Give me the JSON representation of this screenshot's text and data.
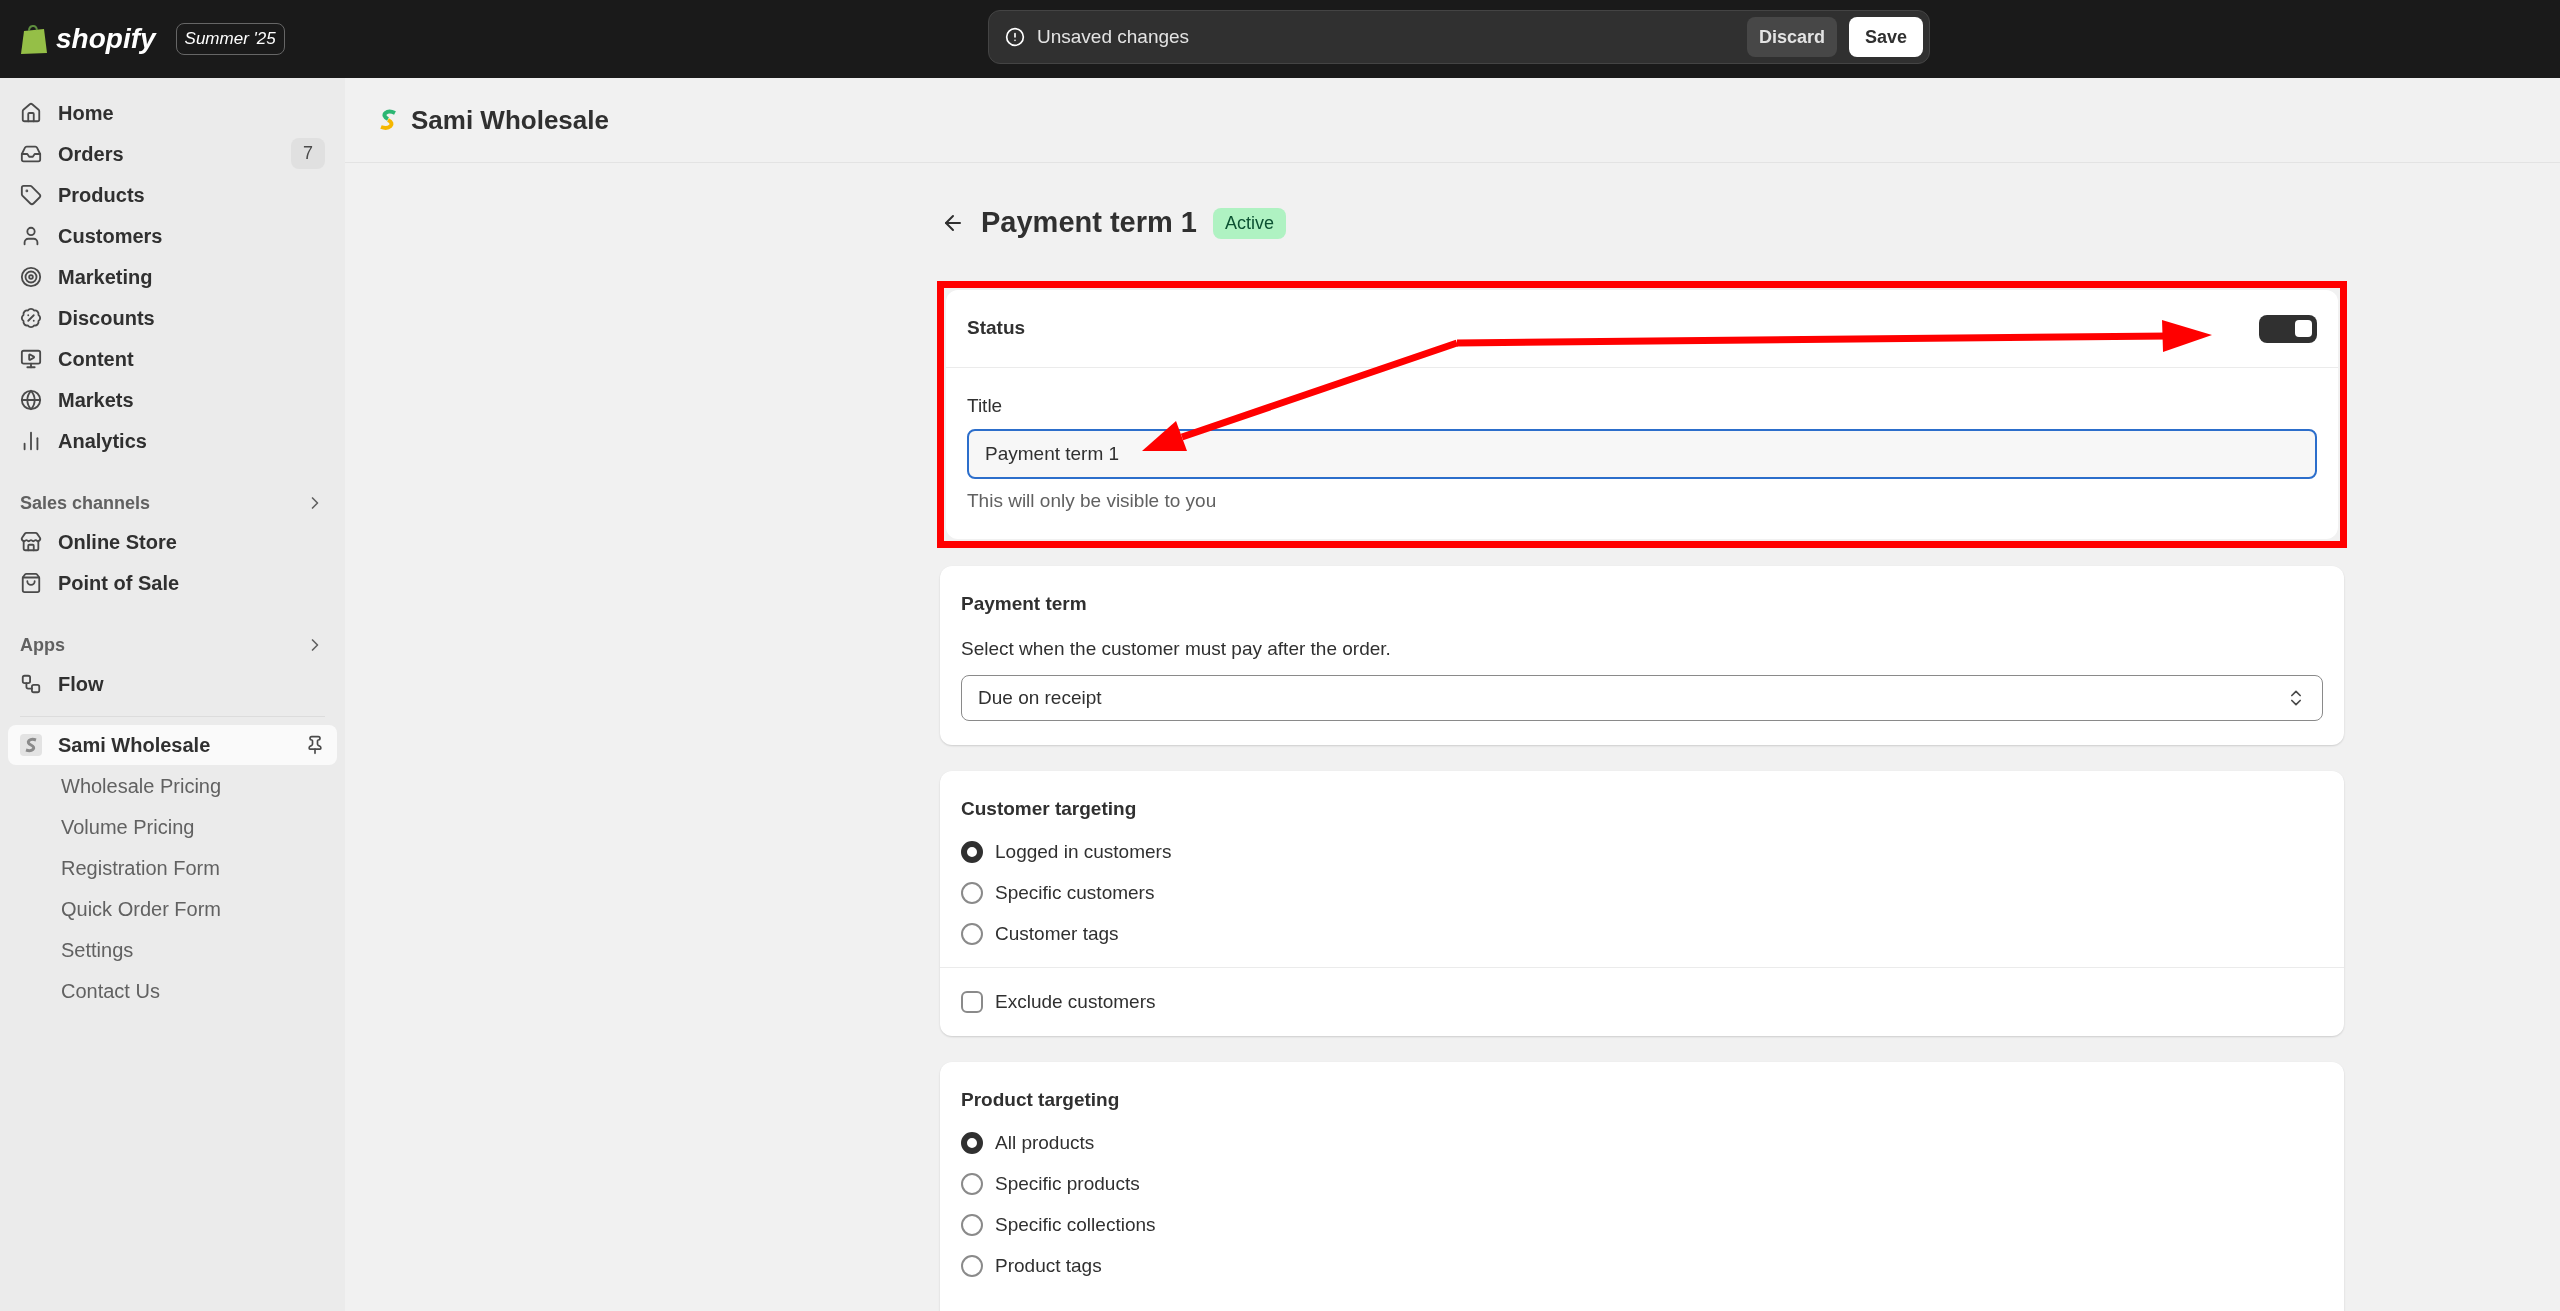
{
  "top_bar": {
    "logo": "shopify",
    "edition": "Summer '25",
    "notice": "Unsaved changes",
    "buttons": [
      {
        "label": "Discard",
        "kind": "secondary"
      },
      {
        "label": "Save",
        "kind": "primary"
      }
    ]
  },
  "sidebar": {
    "items": [
      {
        "label": "Home"
      },
      {
        "label": "Orders",
        "badge": "7"
      },
      {
        "label": "Products"
      },
      {
        "label": "Customers"
      },
      {
        "label": "Marketing"
      },
      {
        "label": "Discounts"
      },
      {
        "label": "Content"
      },
      {
        "label": "Markets"
      },
      {
        "label": "Analytics"
      }
    ],
    "sections": [
      {
        "title": "Sales channels",
        "items": [
          {
            "label": "Online Store"
          },
          {
            "label": "Point of Sale"
          }
        ]
      },
      {
        "title": "Apps",
        "items": [
          {
            "label": "Flow"
          }
        ]
      }
    ],
    "app": {
      "name": "Sami Wholesale",
      "selected": true,
      "children": [
        {
          "label": "Wholesale Pricing"
        },
        {
          "label": "Volume Pricing"
        },
        {
          "label": "Registration Form"
        },
        {
          "label": "Quick Order Form"
        },
        {
          "label": "Settings"
        },
        {
          "label": "Contact Us"
        }
      ]
    }
  },
  "header": {
    "title": "Sami Wholesale"
  },
  "page": {
    "title": "Payment term 1",
    "badge": "Active",
    "status_card": {
      "label": "Status",
      "on": true,
      "field_label": "Title",
      "value": "Payment term 1",
      "help": "This will only be visible to you"
    },
    "payment_card": {
      "heading": "Payment term",
      "description": "Select when the customer must pay after the order.",
      "value": "Due on receipt"
    },
    "customer_card": {
      "heading": "Customer targeting",
      "options": [
        {
          "label": "Logged in customers",
          "selected": true
        },
        {
          "label": "Specific customers",
          "selected": false
        },
        {
          "label": "Customer tags",
          "selected": false
        }
      ],
      "exclude": {
        "label": "Exclude customers",
        "checked": false
      }
    },
    "product_card": {
      "heading": "Product targeting",
      "options": [
        {
          "label": "All products",
          "selected": true
        },
        {
          "label": "Specific products",
          "selected": false
        },
        {
          "label": "Specific collections",
          "selected": false
        },
        {
          "label": "Product tags",
          "selected": false
        }
      ]
    }
  }
}
